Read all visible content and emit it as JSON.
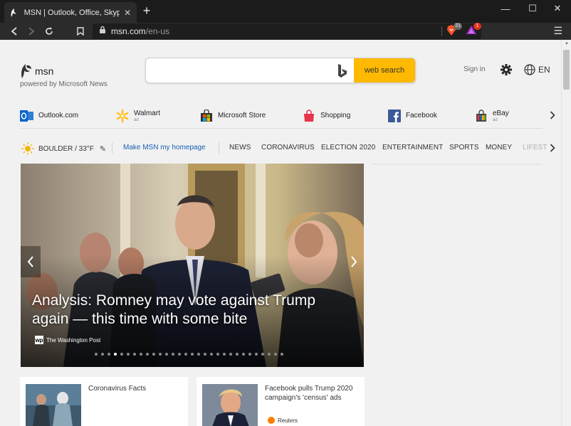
{
  "browser": {
    "tab_title": "MSN | Outlook, Office, Skype, Bing,",
    "url_host": "msn.com",
    "url_path": "/en-us",
    "brave_badge": "21",
    "rewards_badge": "1"
  },
  "header": {
    "logo_text": "msn",
    "powered_by": "powered by Microsoft News",
    "search": {
      "placeholder": "",
      "button_label": "web search"
    },
    "sign_in": "Sign in",
    "language": "EN"
  },
  "shortcuts": [
    {
      "label": "Outlook.com",
      "ad": ""
    },
    {
      "label": "Walmart",
      "ad": "ad"
    },
    {
      "label": "Microsoft Store",
      "ad": ""
    },
    {
      "label": "Shopping",
      "ad": ""
    },
    {
      "label": "Facebook",
      "ad": ""
    },
    {
      "label": "eBay",
      "ad": "ad"
    }
  ],
  "nav": {
    "weather": "BOULDER / 33°F",
    "make_home": "Make MSN my homepage",
    "items": [
      "NEWS",
      "CORONAVIRUS",
      "ELECTION 2020",
      "ENTERTAINMENT",
      "SPORTS",
      "MONEY",
      "LIFEST"
    ]
  },
  "hero": {
    "headline": "Analysis: Romney may vote against Trump again — this time with some bite",
    "source": "The Washington Post",
    "dot_count": 30,
    "active_dot": 3
  },
  "cards": [
    {
      "title": "Coronavirus Facts",
      "source": ""
    },
    {
      "title": "Facebook pulls Trump 2020 campaign's 'census' ads",
      "source": "Reuters"
    }
  ],
  "colors": {
    "search_button": "#ffb900",
    "link": "#1a5fb4"
  }
}
